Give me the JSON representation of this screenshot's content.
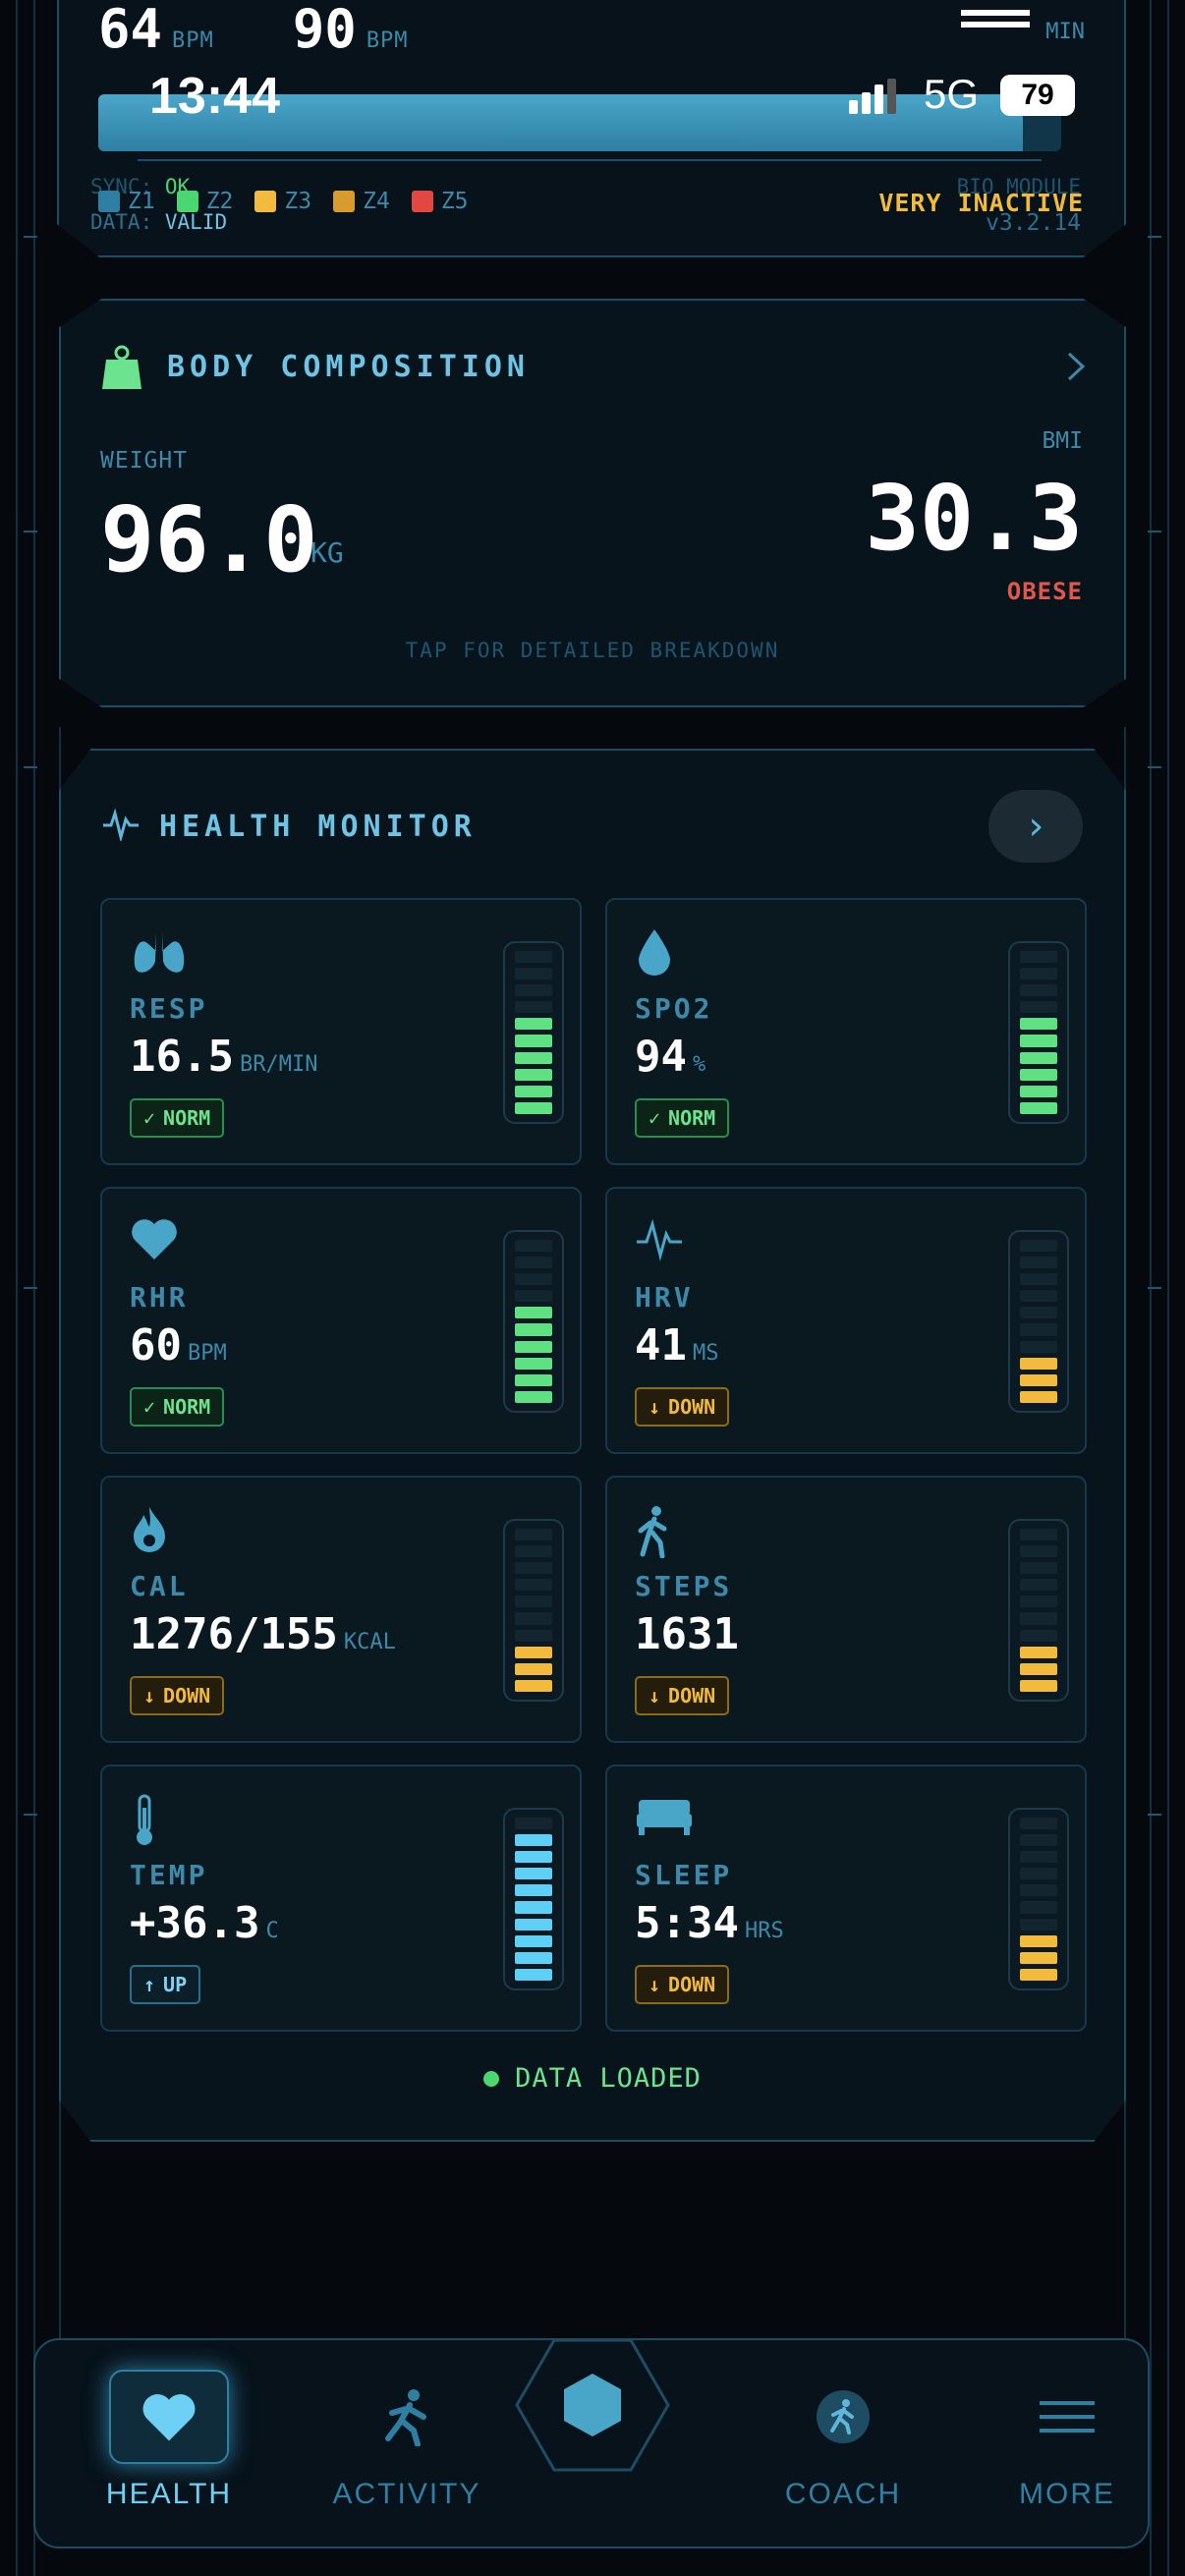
{
  "top_panel": {
    "metric_a_value": "64",
    "metric_a_unit": "BPM",
    "metric_b_value": "90",
    "metric_b_unit": "BPM",
    "duration_unit": "MIN",
    "zone_progress_fraction": 0.96,
    "zones": [
      {
        "label": "Z1",
        "color": "#2f7fa3"
      },
      {
        "label": "Z2",
        "color": "#4bd672"
      },
      {
        "label": "Z3",
        "color": "#f3bb3d"
      },
      {
        "label": "Z4",
        "color": "#d99a2e"
      },
      {
        "label": "Z5",
        "color": "#e2483f"
      }
    ],
    "sync_label": "SYNC:",
    "sync_value": "OK",
    "data_label": "DATA:",
    "data_value": "VALID",
    "module_label": "BIO MODULE",
    "activity_status": "VERY INACTIVE",
    "version": "v3.2.14"
  },
  "status_bar": {
    "time": "13:44",
    "network": "5G",
    "battery": "79"
  },
  "body_composition": {
    "title": "BODY COMPOSITION",
    "weight_label": "WEIGHT",
    "weight_value": "96.0",
    "weight_unit": "KG",
    "bmi_label": "BMI",
    "bmi_value": "30.3",
    "bmi_status": "OBESE",
    "hint": "TAP FOR DETAILED BREAKDOWN"
  },
  "health_monitor": {
    "title": "HEALTH MONITOR",
    "metrics": [
      {
        "name": "RESP",
        "value": "16.5",
        "unit": "BR/MIN",
        "status": "NORM",
        "level": 6,
        "icon": "lungs-icon"
      },
      {
        "name": "SPO2",
        "value": "94",
        "unit": "%",
        "status": "NORM",
        "level": 6,
        "icon": "droplet-icon"
      },
      {
        "name": "RHR",
        "value": "60",
        "unit": "BPM",
        "status": "NORM",
        "level": 6,
        "icon": "heart-icon"
      },
      {
        "name": "HRV",
        "value": "41",
        "unit": "MS",
        "status": "DOWN",
        "level": 3,
        "icon": "pulse-icon"
      },
      {
        "name": "CAL",
        "value": "1276/155",
        "unit": "KCAL",
        "status": "DOWN",
        "level": 3,
        "icon": "flame-icon"
      },
      {
        "name": "STEPS",
        "value": "1631",
        "unit": "",
        "status": "DOWN",
        "level": 3,
        "icon": "walking-icon"
      },
      {
        "name": "TEMP",
        "value": "+36.3",
        "unit": "C",
        "status": "UP",
        "level": 9,
        "icon": "thermometer-icon"
      },
      {
        "name": "SLEEP",
        "value": "5:34",
        "unit": "HRS",
        "status": "DOWN",
        "level": 3,
        "icon": "bed-icon"
      }
    ],
    "gauge_segments": 10,
    "footer": "DATA LOADED"
  },
  "colors": {
    "norm": "#5fe082",
    "down": "#f3bb3d",
    "up": "#5fd0f5",
    "accent": "#4aa6c9",
    "alert": "#e2574c"
  },
  "nav": {
    "items": [
      {
        "label": "HEALTH",
        "icon": "heart-icon",
        "active": true
      },
      {
        "label": "ACTIVITY",
        "icon": "running-icon",
        "active": false
      },
      {
        "label": "COACH",
        "icon": "coach-icon",
        "active": false
      },
      {
        "label": "MORE",
        "icon": "menu-icon",
        "active": false
      }
    ]
  }
}
